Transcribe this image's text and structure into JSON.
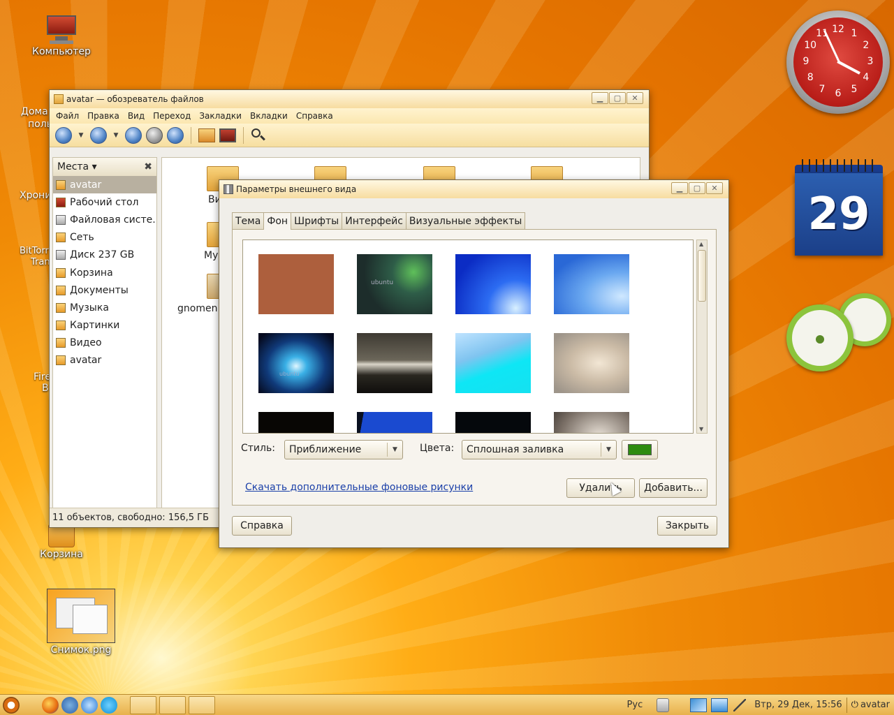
{
  "desktop": {
    "icons": [
      {
        "label": "Компьютер"
      },
      {
        "label": "Корзина"
      },
      {
        "label": "Снимок.png"
      }
    ],
    "partial_labels": [
      "Дома",
      "поль",
      "Хрони",
      "BitTorr",
      "Tran",
      "Fire",
      "B"
    ],
    "calendar_day": "29",
    "clock_numbers": [
      "12",
      "1",
      "2",
      "3",
      "4",
      "5",
      "6",
      "7",
      "8",
      "9",
      "10",
      "11"
    ]
  },
  "file_manager": {
    "title": "avatar — обозреватель файлов",
    "menu": [
      "Файл",
      "Правка",
      "Вид",
      "Переход",
      "Закладки",
      "Вкладки",
      "Справка"
    ],
    "sidebar_header": "Места",
    "places": [
      {
        "label": "avatar",
        "selected": true
      },
      {
        "label": "Рабочий стол"
      },
      {
        "label": "Файловая систе..."
      },
      {
        "label": "Сеть"
      },
      {
        "label": "Диск 237 GB"
      },
      {
        "label": "Корзина"
      },
      {
        "label": "Документы"
      },
      {
        "label": "Музыка"
      },
      {
        "label": "Картинки"
      },
      {
        "label": "Видео"
      },
      {
        "label": "avatar"
      }
    ],
    "files_partial": [
      "Ви",
      "Му",
      "gnomen"
    ],
    "status": "11 объектов, свободно: 156,5 ГБ"
  },
  "dialog": {
    "title": "Параметры внешнего вида",
    "tabs": [
      "Тема",
      "Фон",
      "Шрифты",
      "Интерфейс",
      "Визуальные эффекты"
    ],
    "active_tab": "Фон",
    "thumbnail_captions": [
      "ubuntu",
      "ubuntu"
    ],
    "style_label": "Стиль:",
    "style_value": "Приближение",
    "colors_label": "Цвета:",
    "colors_value": "Сплошная заливка",
    "color_swatch": "#2e8b10",
    "download_link": "Скачать дополнительные фоновые рисунки",
    "remove_button": "Удалить",
    "add_button": "Добавить...",
    "help_button": "Справка",
    "close_button": "Закрыть"
  },
  "taskbar": {
    "keyboard_layout": "Рус",
    "datetime": "Втр, 29 Дек, 15:56",
    "user": "avatar"
  }
}
